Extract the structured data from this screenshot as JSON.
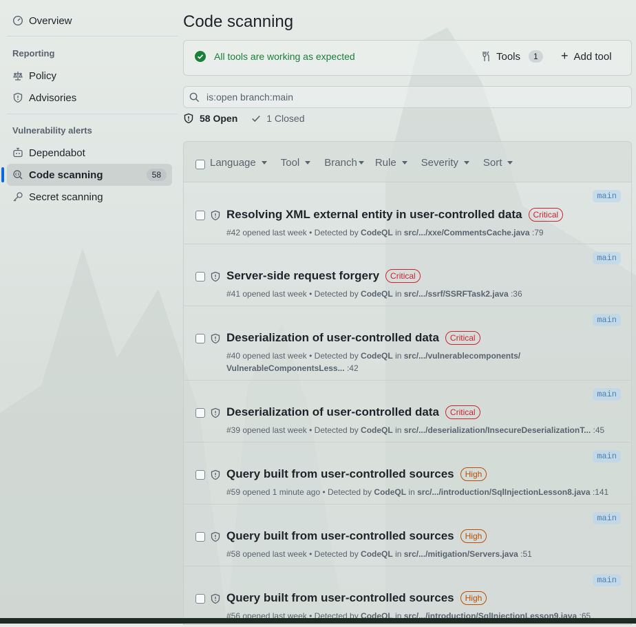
{
  "sidebar": {
    "overview": "Overview",
    "reporting_heading": "Reporting",
    "policy": "Policy",
    "advisories": "Advisories",
    "vuln_heading": "Vulnerability alerts",
    "dependabot": "Dependabot",
    "code_scanning": "Code scanning",
    "code_scanning_count": "58",
    "secret_scanning": "Secret scanning"
  },
  "header": {
    "title": "Code scanning"
  },
  "status": {
    "message": "All tools are working as expected",
    "tools_label": "Tools",
    "tools_count": "1",
    "add_tool_label": "Add tool",
    "ok_color": "#1a7f37"
  },
  "search": {
    "value": "is:open branch:main"
  },
  "counts": {
    "open": "58 Open",
    "closed": "1 Closed"
  },
  "filters": [
    "Language",
    "Tool",
    "Branch",
    "Rule",
    "Severity",
    "Sort"
  ],
  "alerts": [
    {
      "branch": "main",
      "title": "Resolving XML external entity in user-controlled data",
      "severity": "Critical",
      "num": "#42",
      "opened": "opened last week",
      "detected_by": "Detected by",
      "tool": "CodeQL",
      "in": "in",
      "path": "src/.../xxe/CommentsCache.java",
      "line": ":79",
      "path2": ""
    },
    {
      "branch": "main",
      "title": "Server-side request forgery",
      "severity": "Critical",
      "num": "#41",
      "opened": "opened last week",
      "detected_by": "Detected by",
      "tool": "CodeQL",
      "in": "in",
      "path": "src/.../ssrf/SSRFTask2.java",
      "line": ":36",
      "path2": ""
    },
    {
      "branch": "main",
      "title": "Deserialization of user-controlled data",
      "severity": "Critical",
      "num": "#40",
      "opened": "opened last week",
      "detected_by": "Detected by",
      "tool": "CodeQL",
      "in": "in",
      "path": "src/.../vulnerablecomponents/",
      "line": ":42",
      "path2": "VulnerableComponentsLess..."
    },
    {
      "branch": "main",
      "title": "Deserialization of user-controlled data",
      "severity": "Critical",
      "num": "#39",
      "opened": "opened last week",
      "detected_by": "Detected by",
      "tool": "CodeQL",
      "in": "in",
      "path": "src/.../deserialization/InsecureDeserializationT...",
      "line": ":45",
      "path2": ""
    },
    {
      "branch": "main",
      "title": "Query built from user-controlled sources",
      "severity": "High",
      "num": "#59",
      "opened": "opened 1 minute ago",
      "detected_by": "Detected by",
      "tool": "CodeQL",
      "in": "in",
      "path": "src/.../introduction/SqlInjectionLesson8.java",
      "line": ":141",
      "path2": ""
    },
    {
      "branch": "main",
      "title": "Query built from user-controlled sources",
      "severity": "High",
      "num": "#58",
      "opened": "opened last week",
      "detected_by": "Detected by",
      "tool": "CodeQL",
      "in": "in",
      "path": "src/.../mitigation/Servers.java",
      "line": ":51",
      "path2": ""
    },
    {
      "branch": "main",
      "title": "Query built from user-controlled sources",
      "severity": "High",
      "num": "#56",
      "opened": "opened last week",
      "detected_by": "Detected by",
      "tool": "CodeQL",
      "in": "in",
      "path": "src/.../introduction/SqlInjectionLesson9.java",
      "line": ":65",
      "path2": ""
    }
  ],
  "colors": {
    "critical": "#cf222e",
    "high": "#bc4c00",
    "accent": "#0969da"
  }
}
